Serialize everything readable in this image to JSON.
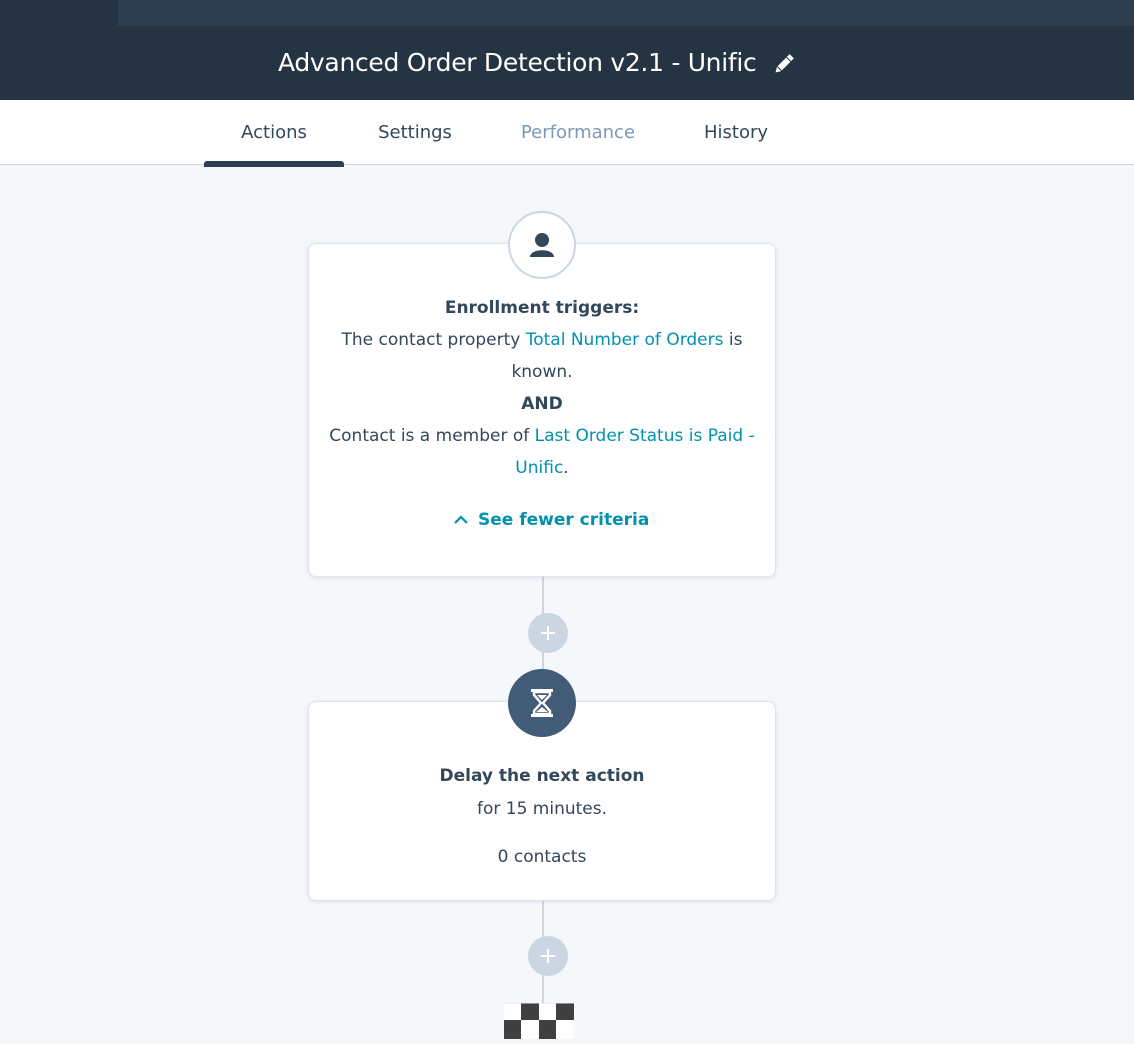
{
  "header": {
    "title": "Advanced Order Detection v2.1 - Unific",
    "edit_icon": "pencil-icon"
  },
  "tabs": [
    {
      "label": "Actions",
      "active": true
    },
    {
      "label": "Settings",
      "active": false
    },
    {
      "label": "Performance",
      "active": false,
      "disabled": true
    },
    {
      "label": "History",
      "active": false
    }
  ],
  "trigger_card": {
    "icon": "contact-icon",
    "heading": "Enrollment triggers:",
    "line1_prefix": "The contact property ",
    "line1_link": "Total Number of Orders",
    "line1_suffix": " is",
    "line2": "known.",
    "operator": "AND",
    "line3_prefix": "Contact is a member of ",
    "line3_link": "Last Order Status is Paid -",
    "line4_link": "Unific",
    "line4_suffix": ".",
    "toggle_label": "See fewer criteria"
  },
  "delay_card": {
    "icon": "hourglass-icon",
    "heading": "Delay the next action",
    "detail": "for 15 minutes.",
    "count": "0 contacts"
  },
  "plus_icon": "plus-icon",
  "end_icon": "checkered-flag-icon",
  "colors": {
    "header_bg": "#253342",
    "link": "#0091ae",
    "text": "#33475b",
    "page_bg": "#f5f8fa"
  }
}
